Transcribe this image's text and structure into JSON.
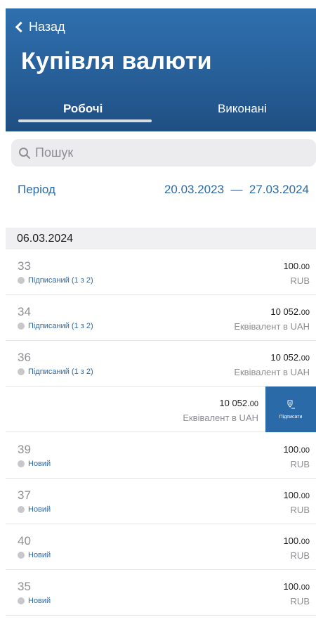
{
  "header": {
    "back_label": "Назад",
    "title": "Купівля валюти",
    "tabs": [
      {
        "label": "Робочі",
        "active": true
      },
      {
        "label": "Виконані",
        "active": false
      }
    ]
  },
  "search": {
    "placeholder": "Пошук",
    "icon": "search-icon"
  },
  "period": {
    "label": "Період",
    "range": "20.03.2023  —  27.03.2024"
  },
  "group": {
    "date": "06.03.2024"
  },
  "rows": [
    {
      "number": "33",
      "status": "Підписаний (1 з 2)",
      "amount_int": "100.",
      "amount_dec": "00",
      "currency": "RUB"
    },
    {
      "number": "34",
      "status": "Підписаний (1 з 2)",
      "amount_int": "10 052.",
      "amount_dec": "00",
      "currency": "Еквівалент в UAH"
    },
    {
      "number": "36",
      "status": "Підписаний (1 з 2)",
      "amount_int": "10 052.",
      "amount_dec": "00",
      "currency": "Еквівалент в UAH"
    },
    {
      "number": "39",
      "status": "Новий",
      "amount_int": "100.",
      "amount_dec": "00",
      "currency": "RUB"
    },
    {
      "number": "37",
      "status": "Новий",
      "amount_int": "100.",
      "amount_dec": "00",
      "currency": "RUB"
    },
    {
      "number": "40",
      "status": "Новий",
      "amount_int": "100.",
      "amount_dec": "00",
      "currency": "RUB"
    },
    {
      "number": "35",
      "status": "Новий",
      "amount_int": "100.",
      "amount_dec": "00",
      "currency": "RUB"
    }
  ],
  "swiped_row": {
    "amount_int": "10 052.",
    "amount_dec": "00",
    "currency": "Еквівалент в UAH",
    "action_label": "Підписати",
    "action_icon": "pen-nib-icon"
  },
  "colors": {
    "header_top": "#2f6fae",
    "header_bottom": "#1f4f82",
    "accent": "#2b6aa8",
    "status_dot": "#c7c7cc"
  }
}
